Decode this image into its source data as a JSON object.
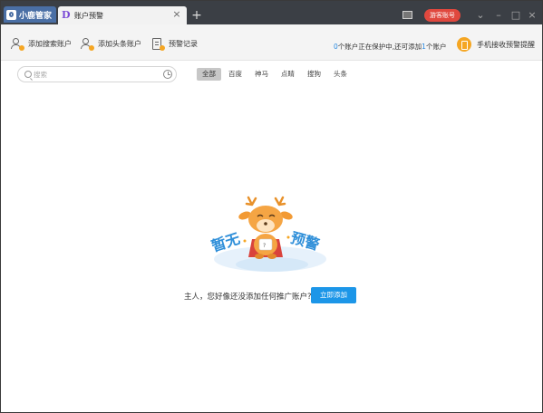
{
  "app": {
    "name": "小鹿管家"
  },
  "tab": {
    "label": "账户预警"
  },
  "titlebar": {
    "guest_label": "游客账号"
  },
  "toolbar": {
    "add_search_account": "添加搜索账户",
    "add_toutiao_account": "添加头条账户",
    "alert_record": "预警记录",
    "status_protected": "0",
    "status_text_1": "个账户正在保护中,还可添加",
    "status_available": "1",
    "status_text_2": "个账户",
    "phone_alert": "手机接收预警提醒"
  },
  "search": {
    "placeholder": "搜索"
  },
  "filters": [
    "全部",
    "百度",
    "神马",
    "点睛",
    "搜狗",
    "头条"
  ],
  "empty": {
    "word_left": "暂无",
    "word_right": "预警",
    "message": "主人，您好像还没添加任何推广账户?",
    "button": "立即添加"
  },
  "colors": {
    "accent": "#1c96e8",
    "guest": "#e0483e",
    "titlebar": "#3b3f45",
    "badge": "#f5a623"
  }
}
